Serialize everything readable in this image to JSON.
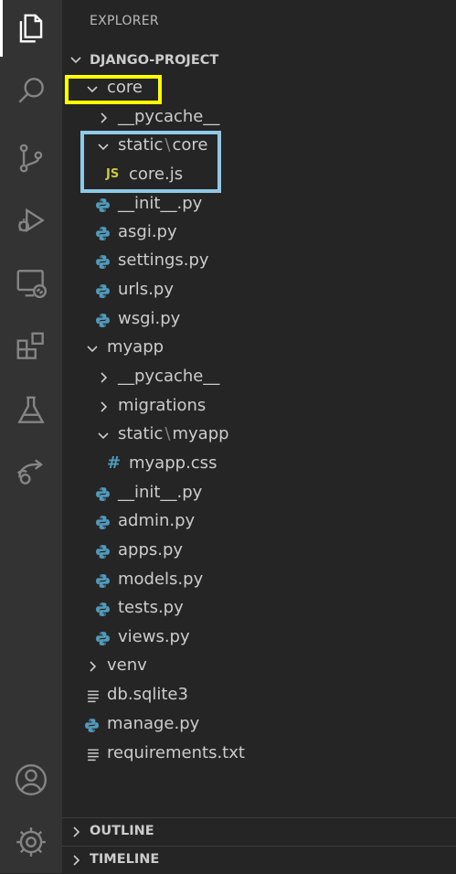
{
  "activity_bar": {
    "items": [
      {
        "name": "explorer",
        "icon": "files-icon",
        "active": true
      },
      {
        "name": "search",
        "icon": "search-icon",
        "active": false
      },
      {
        "name": "source-control",
        "icon": "source-control-icon",
        "active": false
      },
      {
        "name": "run-debug",
        "icon": "debug-icon",
        "active": false
      },
      {
        "name": "remote-explorer",
        "icon": "remote-explorer-icon",
        "active": false
      },
      {
        "name": "extensions",
        "icon": "extensions-icon",
        "active": false
      },
      {
        "name": "testing",
        "icon": "flask-icon",
        "active": false
      },
      {
        "name": "live-share",
        "icon": "live-share-icon",
        "active": false
      }
    ],
    "bottom": [
      {
        "name": "accounts",
        "icon": "account-icon"
      },
      {
        "name": "manage",
        "icon": "gear-icon"
      }
    ]
  },
  "explorer": {
    "title": "EXPLORER",
    "project": "DJANGO-PROJECT",
    "tree": [
      {
        "label": "core",
        "type": "folder",
        "expanded": true
      },
      {
        "label": "__pycache__",
        "type": "folder",
        "expanded": false
      },
      {
        "label_a": "static",
        "label_b": "core",
        "type": "folder",
        "expanded": true
      },
      {
        "label": "core.js",
        "type": "js",
        "badge": "JS"
      },
      {
        "label": "__init__.py",
        "type": "python"
      },
      {
        "label": "asgi.py",
        "type": "python"
      },
      {
        "label": "settings.py",
        "type": "python"
      },
      {
        "label": "urls.py",
        "type": "python"
      },
      {
        "label": "wsgi.py",
        "type": "python"
      },
      {
        "label": "myapp",
        "type": "folder",
        "expanded": true
      },
      {
        "label": "__pycache__",
        "type": "folder",
        "expanded": false
      },
      {
        "label": "migrations",
        "type": "folder",
        "expanded": false
      },
      {
        "label_a": "static",
        "label_b": "myapp",
        "type": "folder",
        "expanded": true
      },
      {
        "label": "myapp.css",
        "type": "css",
        "badge": "#"
      },
      {
        "label": "__init__.py",
        "type": "python"
      },
      {
        "label": "admin.py",
        "type": "python"
      },
      {
        "label": "apps.py",
        "type": "python"
      },
      {
        "label": "models.py",
        "type": "python"
      },
      {
        "label": "tests.py",
        "type": "python"
      },
      {
        "label": "views.py",
        "type": "python"
      },
      {
        "label": "venv",
        "type": "folder",
        "expanded": false
      },
      {
        "label": "db.sqlite3",
        "type": "text"
      },
      {
        "label": "manage.py",
        "type": "python"
      },
      {
        "label": "requirements.txt",
        "type": "text"
      }
    ],
    "separator": "\\"
  },
  "panels": {
    "outline": "OUTLINE",
    "timeline": "TIMELINE"
  },
  "colors": {
    "activity_bg": "#333333",
    "sidebar_bg": "#252526",
    "python_icon": "#519aba",
    "js_icon": "#cbcb41",
    "highlight_yellow": "#ffff00",
    "highlight_blue": "#8ecae6"
  }
}
